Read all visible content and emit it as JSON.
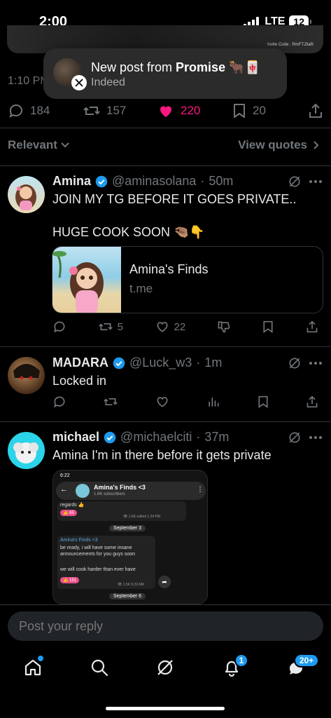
{
  "status_bar": {
    "time": "2:00",
    "network": "LTE",
    "battery": "12"
  },
  "top_media": {
    "invite_text": "Invite Code : RmFTJ3aR"
  },
  "notification": {
    "title_prefix": "New post from ",
    "author": "Promise",
    "emoji": "🐂🀄",
    "subtitle": "Indeed"
  },
  "main_post": {
    "time": "1:10 PM",
    "replies": "184",
    "reposts": "157",
    "likes": "220",
    "bookmarks": "20"
  },
  "sort": {
    "relevant_label": "Relevant",
    "view_quotes_label": "View quotes"
  },
  "replies": [
    {
      "name": "Amina",
      "handle": "@aminasolana",
      "time": "50m",
      "text_line1": "JOIN MY TG BEFORE IT GOES PRIVATE..",
      "text_line2": "HUGE COOK SOON 🤏🏽👇",
      "card_title": "Amina's Finds",
      "card_domain": "t.me",
      "reposts": "5",
      "likes": "22"
    },
    {
      "name": "MADARA",
      "handle": "@Luck_w3",
      "time": "1m",
      "text": "Locked in"
    },
    {
      "name": "michael",
      "handle": "@michaelciti",
      "time": "37m",
      "text": "Amina I'm in there before it gets private"
    }
  ],
  "tg_screenshot": {
    "time": "6:22",
    "channel": "Amina's Finds <3",
    "subscribers": "1.6K subscribers",
    "regards": "regards 👍",
    "reaction1": "👍 85",
    "meta1": "👁 1.6K  edited 1:24 PM",
    "date1": "September 3",
    "msg_author": "Amina's Finds <3",
    "msg_line1": "be ready, i will have some insane",
    "msg_line2": "announcements for you guys soon",
    "msg_line3": "we will cook harder than ever have",
    "reaction2": "👍 151",
    "meta2": "👁 1.5K  9:22 AM",
    "date2": "September 6"
  },
  "reply_bar": {
    "placeholder": "Post your reply"
  },
  "bottom_nav": {
    "notifications_badge": "1",
    "messages_badge": "20+"
  }
}
